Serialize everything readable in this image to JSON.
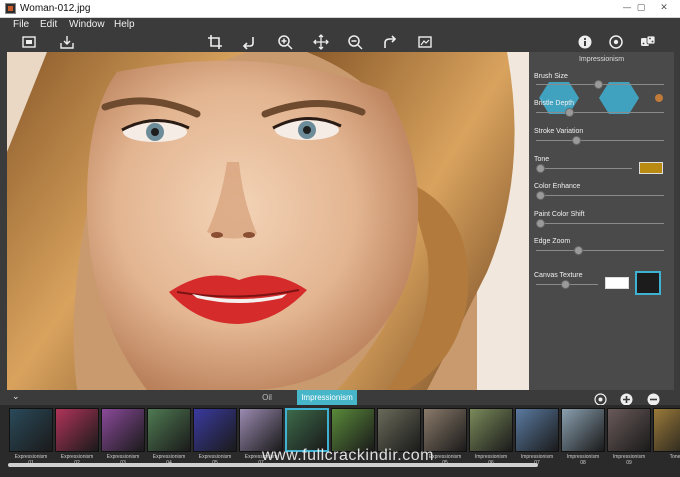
{
  "window": {
    "title": "Woman-012.jpg",
    "minimize_glyph": "—",
    "maximize_glyph": "▢",
    "close_glyph": "✕"
  },
  "menu": {
    "items": [
      "File",
      "Edit",
      "Window",
      "Help"
    ]
  },
  "toolbar": {
    "left_icons": [
      "fit-screen-icon",
      "save-icon"
    ],
    "center_icons": [
      "crop-icon",
      "undo-icon",
      "zoom-in-icon",
      "move-icon",
      "zoom-out-icon",
      "redo-icon",
      "compare-icon"
    ],
    "right_icons": [
      "info-icon",
      "settings-icon",
      "random-dice-icon"
    ]
  },
  "panel": {
    "title": "Impressionism",
    "params": [
      {
        "label": "Brush Size",
        "value": 0.49
      },
      {
        "label": "Bristle Depth",
        "value": 0.24
      },
      {
        "label": "Stroke Variation",
        "value": 0.3
      },
      {
        "label": "Tone",
        "value": 0.0,
        "swatch_color": "#b98a12"
      },
      {
        "label": "Color Enhance",
        "value": 0.0
      },
      {
        "label": "Paint Color Shift",
        "value": 0.0
      },
      {
        "label": "Edge Zoom",
        "value": 0.32
      },
      {
        "label": "Canvas Texture",
        "value": 0.47,
        "swatch_color": "#ffffff"
      }
    ],
    "accent_color": "#3fb2d4"
  },
  "bottom": {
    "tabs": [
      "Oil",
      "Impressionism"
    ],
    "active_tab": "Impressionism",
    "icons": [
      "preset-icon",
      "add-icon",
      "remove-icon"
    ],
    "collapse_glyph": "⌄"
  },
  "thumbnails": [
    {
      "name": "Expressionism",
      "num": "01",
      "color": "#2a4a5a"
    },
    {
      "name": "Expressionism",
      "num": "02",
      "color": "#b0345a"
    },
    {
      "name": "Expressionism",
      "num": "03",
      "color": "#8a4a9a"
    },
    {
      "name": "Expressionism",
      "num": "04",
      "color": "#4f7a52"
    },
    {
      "name": "Expressionism",
      "num": "05",
      "color": "#3a3aa0"
    },
    {
      "name": "Expressionism",
      "num": "07",
      "color": "#9a8ab0"
    },
    {
      "name": "",
      "num": "",
      "color": "#3c6a4a"
    },
    {
      "name": "",
      "num": "",
      "color": "#5a8a3a"
    },
    {
      "name": "",
      "num": "",
      "color": "#6a6a5a"
    },
    {
      "name": "Expressionism",
      "num": "05",
      "color": "#8a7a6a"
    },
    {
      "name": "Impressionism",
      "num": "06",
      "color": "#7a8a5a"
    },
    {
      "name": "Impressionism",
      "num": "07",
      "color": "#5a7aa0"
    },
    {
      "name": "Impressionism",
      "num": "08",
      "color": "#8aa0b0"
    },
    {
      "name": "Impressionism",
      "num": "09",
      "color": "#6a5a5a"
    },
    {
      "name": "Tone",
      "num": "",
      "color": "#9a7a3a"
    }
  ],
  "watermark": "www.fullcrackindir.com"
}
